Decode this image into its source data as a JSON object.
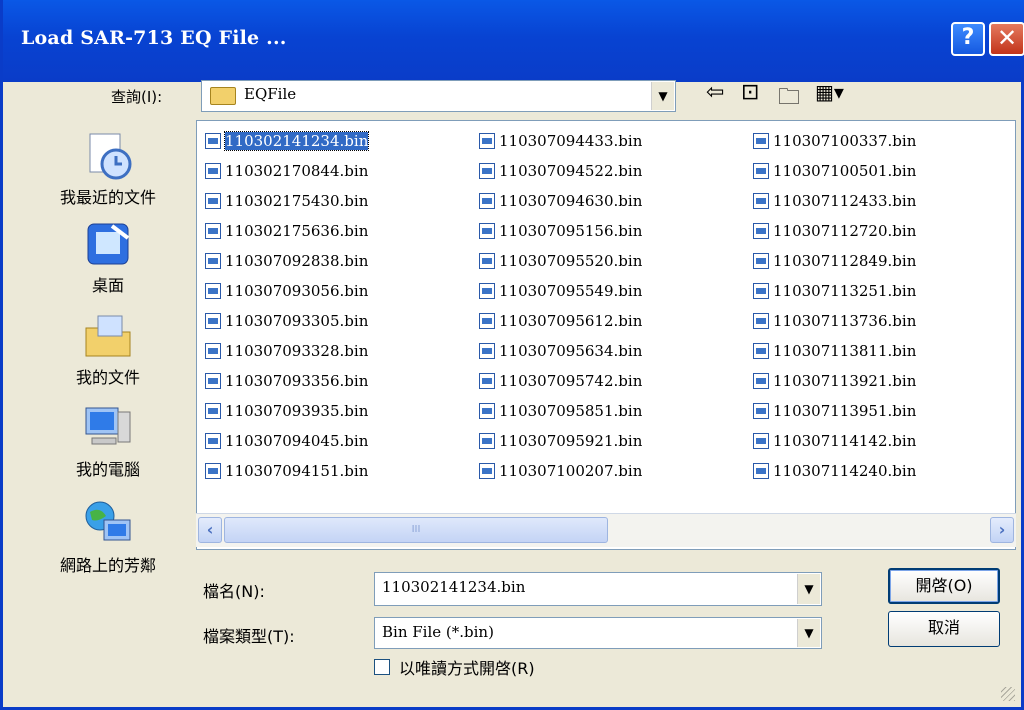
{
  "window": {
    "title": "Load SAR-713 EQ File ...",
    "help_glyph": "?",
    "close_glyph": "✕"
  },
  "look_in": {
    "label": "查詢(I):",
    "value": "EQFile"
  },
  "places": [
    {
      "label": "我最近的文件",
      "icon": "recent-documents-icon"
    },
    {
      "label": "桌面",
      "icon": "desktop-icon"
    },
    {
      "label": "我的文件",
      "icon": "my-documents-icon"
    },
    {
      "label": "我的電腦",
      "icon": "my-computer-icon"
    },
    {
      "label": "網路上的芳鄰",
      "icon": "network-places-icon"
    }
  ],
  "files": [
    "110302141234.bin",
    "110302170844.bin",
    "110302175430.bin",
    "110302175636.bin",
    "110307092838.bin",
    "110307093056.bin",
    "110307093305.bin",
    "110307093328.bin",
    "110307093356.bin",
    "110307093935.bin",
    "110307094045.bin",
    "110307094151.bin",
    "110307094433.bin",
    "110307094522.bin",
    "110307094630.bin",
    "110307095156.bin",
    "110307095520.bin",
    "110307095549.bin",
    "110307095612.bin",
    "110307095634.bin",
    "110307095742.bin",
    "110307095851.bin",
    "110307095921.bin",
    "110307100207.bin",
    "110307100337.bin",
    "110307100501.bin",
    "110307112433.bin",
    "110307112720.bin",
    "110307112849.bin",
    "110307113251.bin",
    "110307113736.bin",
    "110307113811.bin",
    "110307113921.bin",
    "110307113951.bin",
    "110307114142.bin",
    "110307114240.bin"
  ],
  "selected_file": "110302141234.bin",
  "filename": {
    "label": "檔名(N):",
    "value": "110302141234.bin"
  },
  "filetype": {
    "label": "檔案類型(T):",
    "value": "Bin File (*.bin)"
  },
  "readonly_checkbox": {
    "label": "以唯讀方式開啓(R)",
    "checked": false
  },
  "buttons": {
    "open": "開啓(O)",
    "cancel": "取消"
  }
}
